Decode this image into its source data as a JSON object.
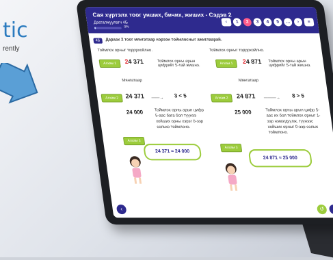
{
  "brand": {
    "text": "tic",
    "sub": "rently"
  },
  "app": {
    "title": "Сая хүртэлх тоог унших, бичих, жиших - Сэдэв 2",
    "subtitle": "Дасгалжуулагч 4Б",
    "progress_pct": "0%",
    "progress_value": 0.05,
    "nav": [
      "1",
      "2",
      "3",
      "4",
      "5"
    ]
  },
  "question": {
    "number": "4Б",
    "text": "Дараах 2 тоог мянгатаар нэрээн тоймлосныг ажиглаарай."
  },
  "left": {
    "intro": "Тоймлох орныг тодорхойлно.",
    "step1_badge": "Алхам 1",
    "num1": "24 371",
    "num1_note": "Тоймлох орны арын цифрийг 5-тай жишнэ.",
    "arrow_label": "Мянгатаар",
    "step2_badge": "Алхам 2",
    "num2": "24 371",
    "compare": "3 < 5",
    "rounded": "24 000",
    "note2": "Тоймлох орны арын цифр 5-аас бага бол түүнээ хойших орны хэрэг 0-ээр солько тоймлоно.",
    "step3_badge": "Алхам 3",
    "bubble": "24 371 ≈ 24 000"
  },
  "right": {
    "intro": "Тоймлох орныг тодорхойлно.",
    "step1_badge": "Алхам 1",
    "num1": "24 871",
    "num1_note": "Тоймлох орны арын цифрийг 5-тай жишнэ.",
    "arrow_label": "Мянгатаар",
    "step2_badge": "Алхам 2",
    "num2": "24 871",
    "compare": "8 > 5",
    "rounded": "25 000",
    "note2": "Тоймлох орны арын цифр 5-аас их бол тоймлох орныг 1-ээр нэмэгдүүлж, түүнээс хойших орныг 0-ээр сольж тоймлоно.",
    "step3_badge": "Алхам 3",
    "bubble": "24 871 ≈ 25 000"
  },
  "colors": {
    "header": "#2e2a8e",
    "accent": "#9ccc3c",
    "highlight": "#e0242b",
    "pink": "#ff5c8a"
  }
}
